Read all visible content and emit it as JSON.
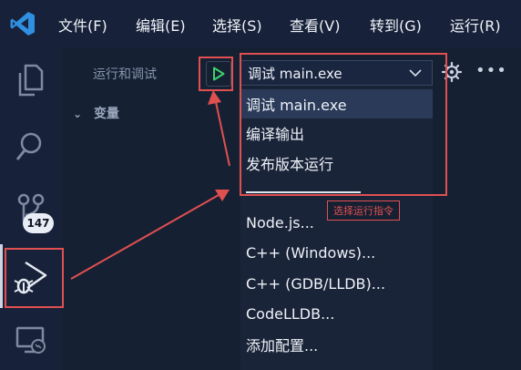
{
  "menubar": {
    "app_icon": "vscode-logo-icon",
    "items": [
      "文件(F)",
      "编辑(E)",
      "选择(S)",
      "查看(V)",
      "转到(G)",
      "运行(R)"
    ]
  },
  "activity_bar": {
    "icons": [
      "files-icon",
      "search-icon",
      "source-control-icon",
      "run-debug-icon",
      "remote-explorer-icon"
    ],
    "badge": "147"
  },
  "sidebar": {
    "title": "运行和调试",
    "variables_label": "变量"
  },
  "toolbar": {
    "run_icon": "play-icon",
    "selected_config": "调试 main.exe",
    "settings_icon": "gear-icon",
    "more_icon": "ellipsis-icon"
  },
  "dropdown": {
    "items": [
      "调试 main.exe",
      "编译输出",
      "发布版本运行"
    ],
    "extra_items": [
      "Node.js...",
      "C++ (Windows)...",
      "C++ (GDB/LLDB)...",
      "CodeLLDB...",
      "添加配置..."
    ]
  },
  "annotation": {
    "tooltip": "选择运行指令",
    "accent_color": "#e05050"
  }
}
